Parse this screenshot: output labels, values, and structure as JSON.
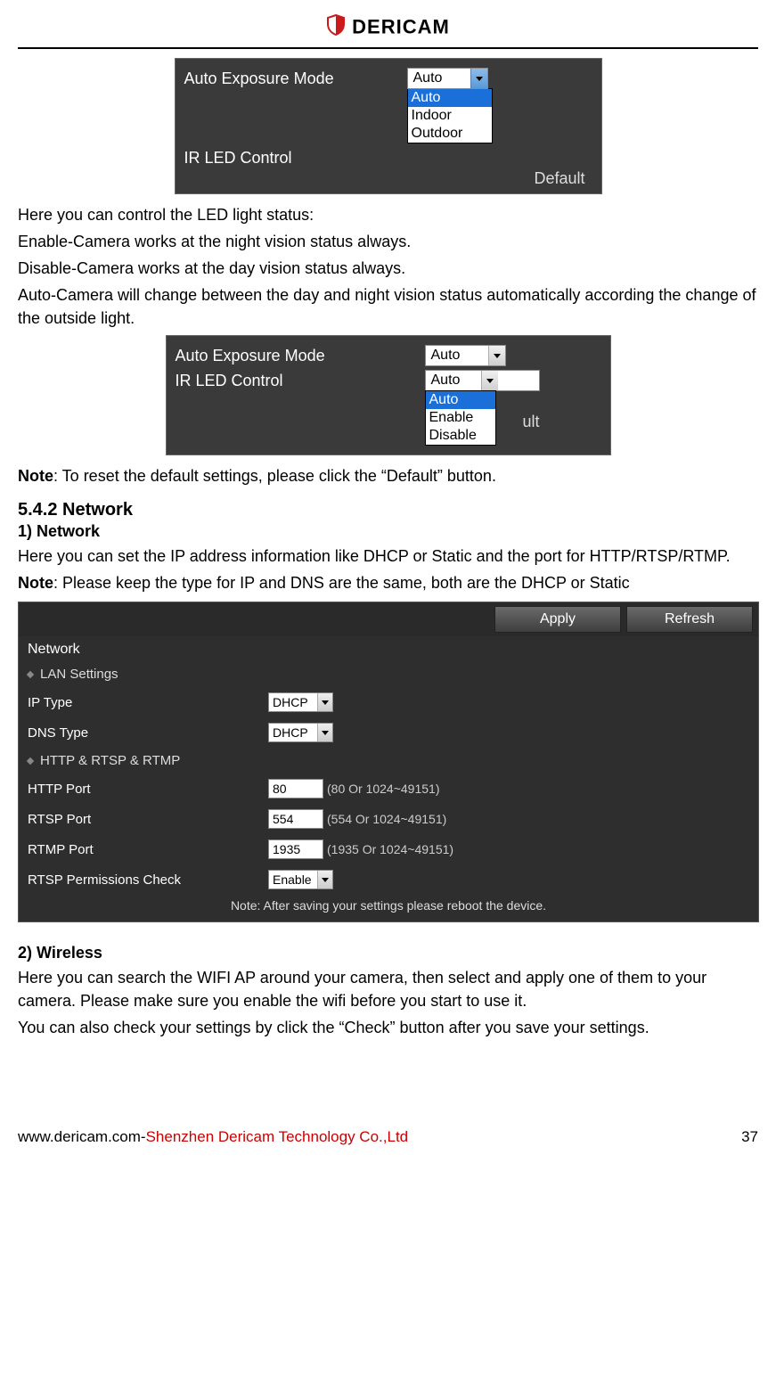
{
  "brand": "DERICAM",
  "panelA": {
    "row1_label": "Auto Exposure Mode",
    "row1_value": "Auto",
    "row1_options": [
      "Auto",
      "Indoor",
      "Outdoor"
    ],
    "row2_label": "IR LED Control",
    "default_btn": "Default"
  },
  "text1": {
    "l1": "Here you can control the LED light status:",
    "l2": "Enable-Camera works at the night vision status always.",
    "l3": "Disable-Camera works at the day vision status always.",
    "l4": "Auto-Camera will change between the day and night vision status automatically according the change of the outside light."
  },
  "panelB": {
    "row1_label": "Auto Exposure Mode",
    "row1_value": "Auto",
    "row2_label": "IR LED Control",
    "row2_value": "Auto",
    "row2_options": [
      "Auto",
      "Enable",
      "Disable"
    ],
    "default_btn": "ult"
  },
  "note1_prefix": "Note",
  "note1_rest": ": To reset the default settings, please click the “Default” button.",
  "sec_542": "5.4.2 Network",
  "sub_1": "1) Network",
  "text2": {
    "l1": "Here you can set the IP address information like DHCP or Static and the port for HTTP/RTSP/RTMP.",
    "l2_prefix": "Note",
    "l2_rest": ": Please keep the type for IP and DNS are the same, both are the DHCP or Static"
  },
  "net": {
    "apply": "Apply",
    "refresh": "Refresh",
    "title": "Network",
    "sec1": "LAN Settings",
    "ip_type_label": "IP Type",
    "ip_type_value": "DHCP",
    "dns_type_label": "DNS Type",
    "dns_type_value": "DHCP",
    "sec2": "HTTP & RTSP & RTMP",
    "http_label": "HTTP Port",
    "http_value": "80",
    "http_hint": "(80 Or 1024~49151)",
    "rtsp_label": "RTSP Port",
    "rtsp_value": "554",
    "rtsp_hint": "(554 Or 1024~49151)",
    "rtmp_label": "RTMP Port",
    "rtmp_value": "1935",
    "rtmp_hint": "(1935 Or 1024~49151)",
    "perm_label": "RTSP Permissions Check",
    "perm_value": "Enable",
    "note": "Note: After saving your settings please reboot the device."
  },
  "sub_2": "2) Wireless",
  "text3": {
    "l1": "Here you can search the WIFI AP around your camera, then select and apply one of them to your camera. Please make sure you enable the wifi before you start to use it.",
    "l2": "You can also check your settings by click the “Check” button after you save your settings."
  },
  "footer": {
    "site": "www.dericam.com-",
    "company": "Shenzhen Dericam Technology Co.,Ltd",
    "page": "37"
  }
}
